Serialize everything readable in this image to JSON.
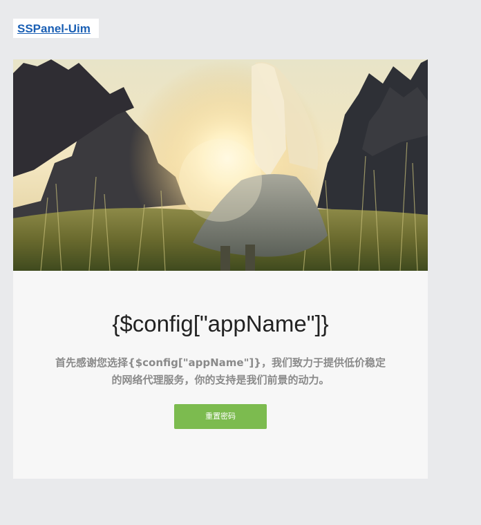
{
  "brand": {
    "link_text": "SSPanel-Uim"
  },
  "hero": {
    "image_alt": "woman in a sunlit meadow at sunset"
  },
  "content": {
    "title": "{$config[\"appName\"]}",
    "intro_line1": "首先感谢您选择{$config[\"appName\"]}，我们致力于提供低价稳定",
    "intro_line2": "的网络代理服务，你的支持是我们前景的动力。",
    "button_label": "重置密码"
  },
  "colors": {
    "page_background": "#e9eaec",
    "card_background": "#f7f7f7",
    "brand_link": "#1a5fb4",
    "button_background": "#7cbb4f",
    "button_text": "#ffffff",
    "title_text": "#222222",
    "body_text": "#8a8a8a"
  }
}
